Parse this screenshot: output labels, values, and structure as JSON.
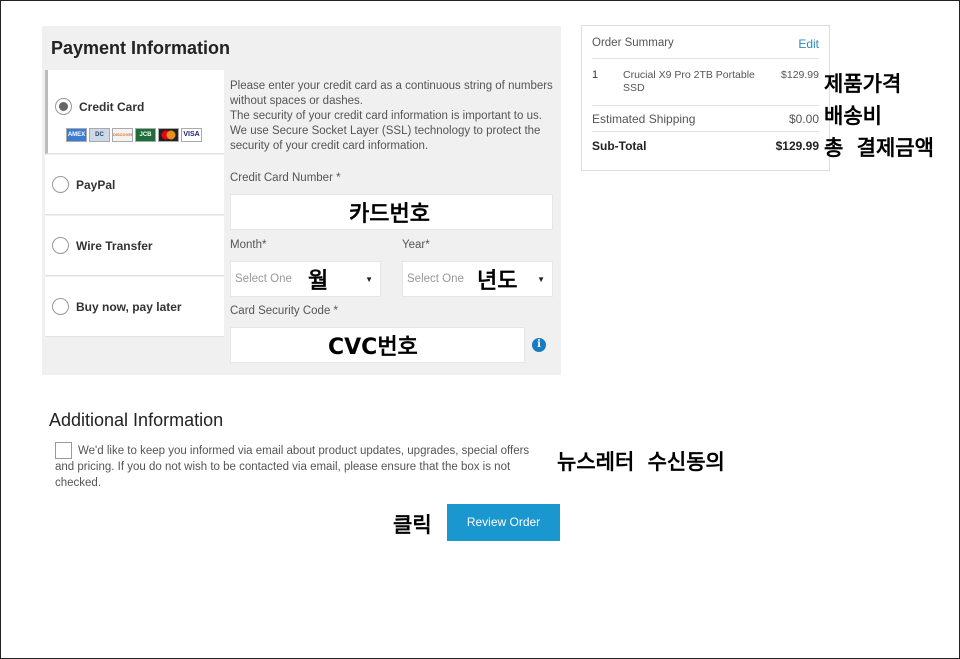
{
  "payment": {
    "title": "Payment Information",
    "methods": [
      {
        "label": "Credit Card",
        "selected": true
      },
      {
        "label": "PayPal",
        "selected": false
      },
      {
        "label": "Wire Transfer",
        "selected": false
      },
      {
        "label": "Buy now, pay later",
        "selected": false
      }
    ],
    "card_logos": [
      "AMEX",
      "DC",
      "DISCOVER",
      "JCB",
      "MC",
      "VISA"
    ],
    "info_text": "Please enter your credit card as a continuous string of numbers without spaces or dashes.\nThe security of your credit card information is important to us. We use Secure Socket Layer (SSL) technology to protect the security of your credit card information.",
    "card_number_label": "Credit Card Number *",
    "month_label": "Month*",
    "year_label": "Year*",
    "select_placeholder": "Select One",
    "cvc_label": "Card Security Code *",
    "info_icon": "info-icon",
    "info_icon_glyph": "i"
  },
  "summary": {
    "header": "Order Summary",
    "edit": "Edit",
    "item_qty": "1",
    "item_name": "Crucial X9 Pro 2TB Portable SSD",
    "item_price": "$129.99",
    "shipping_label": "Estimated Shipping",
    "shipping_value": "$0.00",
    "subtotal_label": "Sub-Total",
    "subtotal_value": "$129.99"
  },
  "additional": {
    "title": "Additional Information",
    "optin_text": "We'd like to keep you informed via email about product updates, upgrades, special offers and pricing. If you do not wish to be contacted via email, please ensure that the box is not checked.",
    "optin_checked": false
  },
  "review_button": "Review Order",
  "annotations": {
    "card_number": "카드번호",
    "month": "월",
    "year": "년도",
    "cvc": "CVC번호",
    "product_price": "제품가격",
    "shipping": "배송비",
    "total": "총 결제금액",
    "newsletter": "뉴스레터 수신동의",
    "click": "클릭"
  },
  "colors": {
    "accent": "#1a97cf",
    "link": "#2a8ac8",
    "panel_bg": "#f0f0f0"
  }
}
